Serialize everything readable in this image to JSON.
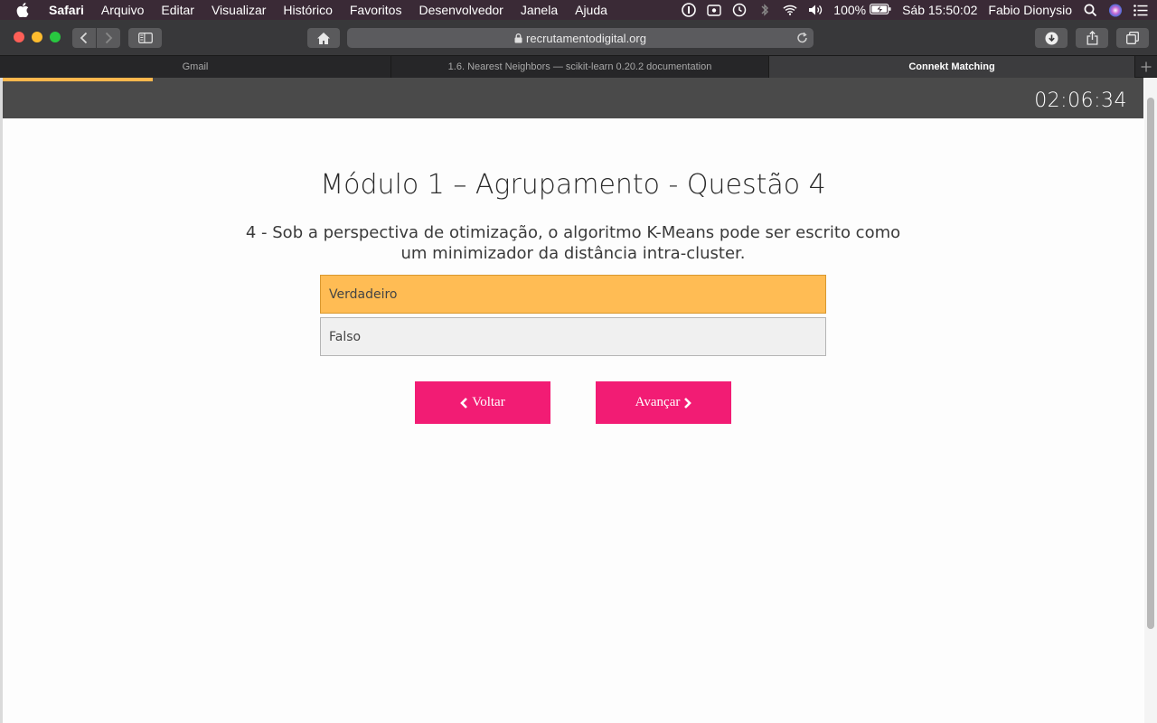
{
  "menubar": {
    "app_name": "Safari",
    "items": [
      "Arquivo",
      "Editar",
      "Visualizar",
      "Histórico",
      "Favoritos",
      "Desenvolvedor",
      "Janela",
      "Ajuda"
    ],
    "battery": "100%",
    "clock": "Sáb 15:50:02",
    "user": "Fabio Dionysio"
  },
  "toolbar": {
    "url": "recrutamentodigital.org"
  },
  "tabs": [
    {
      "label": "Gmail"
    },
    {
      "label": "1.6. Nearest Neighbors — scikit-learn 0.20.2 documentation"
    },
    {
      "label": "Connekt Matching"
    }
  ],
  "page": {
    "timer": "02:06:34",
    "title": "Módulo 1 – Agrupamento - Questão 4",
    "question": "4 - Sob a perspectiva de otimização, o algoritmo K-Means pode ser escrito como um minimizador da distância intra-cluster.",
    "options": [
      {
        "label": "Verdadeiro"
      },
      {
        "label": "Falso"
      }
    ],
    "back_label": "Voltar",
    "next_label": "Avançar"
  },
  "colors": {
    "selected_option": "#ffbc54",
    "button": "#f21c74",
    "progress": "#ffb74d"
  }
}
